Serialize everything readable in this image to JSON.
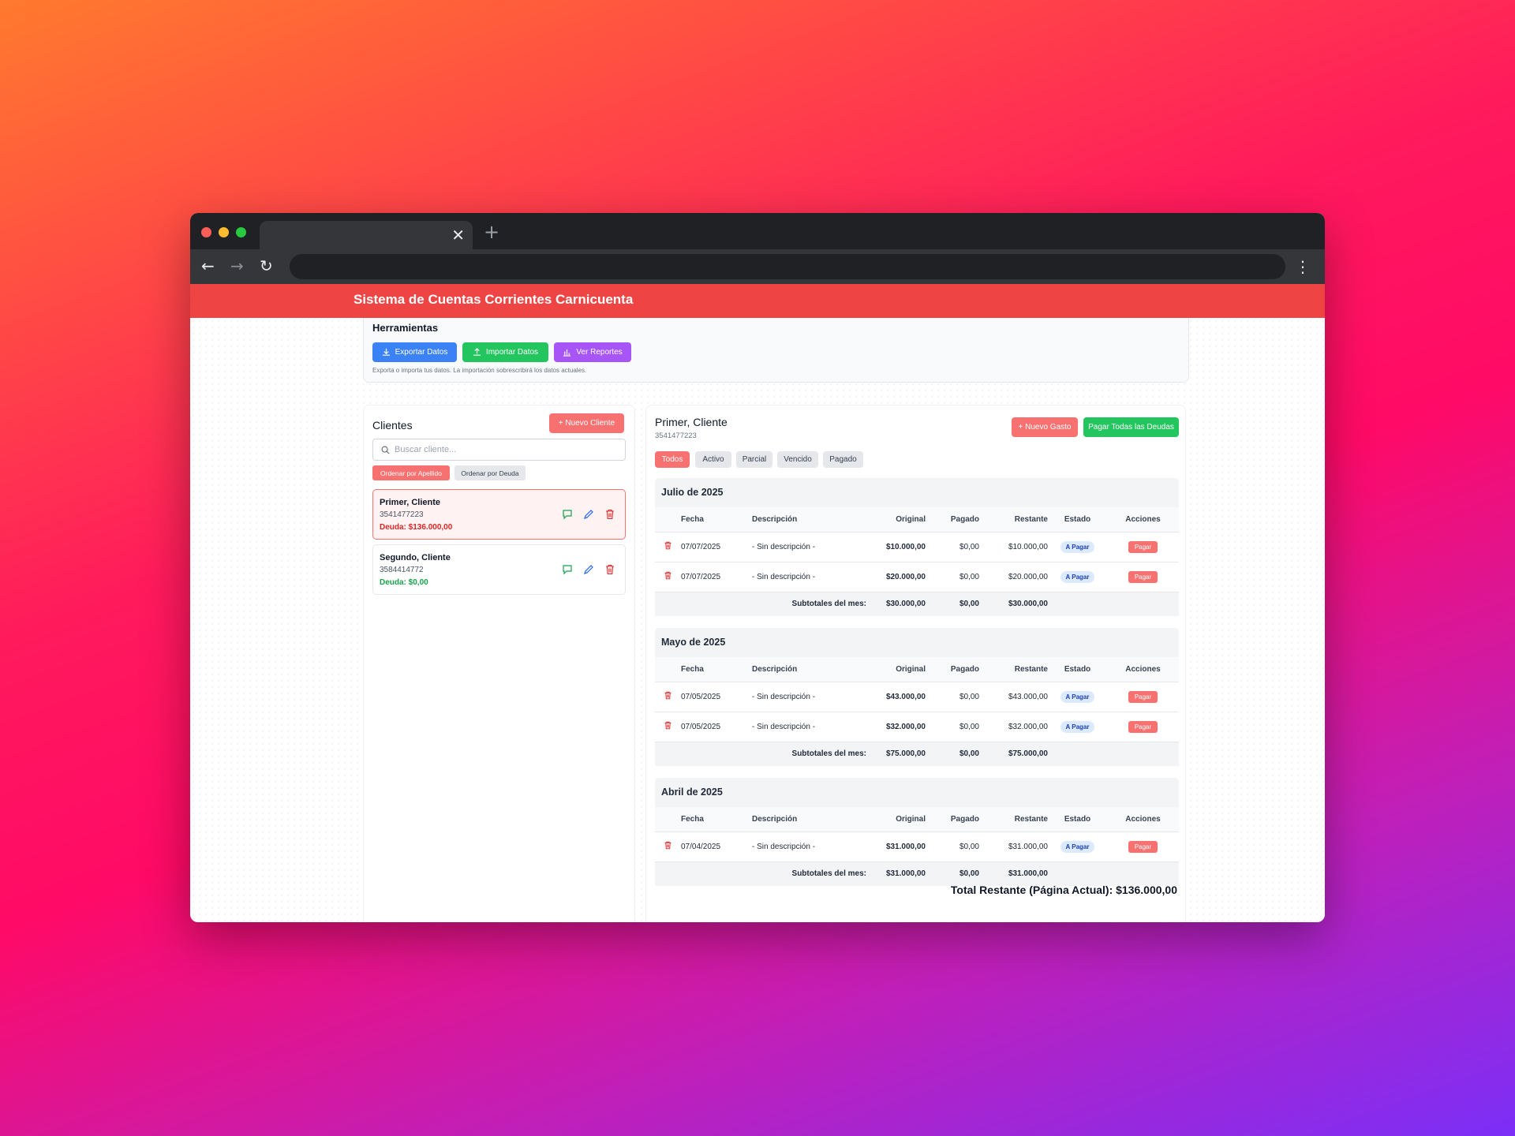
{
  "app": {
    "title": "Sistema de Cuentas Corrientes Carnicuenta"
  },
  "colors": {
    "header": "#ef4444",
    "export": "#3b82f6",
    "import": "#22c55e",
    "reports": "#a855f7",
    "accent": "#f87171"
  },
  "tools": {
    "title": "Herramientas",
    "export_label": "Exportar Datos",
    "import_label": "Importar Datos",
    "reports_label": "Ver Reportes",
    "note": "Exporta o importa tus datos. La importación sobrescribirá los datos actuales."
  },
  "clients": {
    "title": "Clientes",
    "new_label": "+ Nuevo Cliente",
    "search_placeholder": "Buscar cliente...",
    "sort_lastname": "Ordenar por Apellido",
    "sort_debt": "Ordenar por Deuda",
    "items": [
      {
        "name": "Primer, Cliente",
        "phone": "3541477223",
        "debt": "Deuda: $136.000,00"
      },
      {
        "name": "Segundo, Cliente",
        "phone": "3584414772",
        "debt": "Deuda: $0,00"
      }
    ]
  },
  "detail": {
    "name": "Primer, Cliente",
    "phone": "3541477223",
    "new_expense": "+ Nuevo Gasto",
    "pay_all": "Pagar Todas las Deudas",
    "filters": [
      "Todos",
      "Activo",
      "Parcial",
      "Vencido",
      "Pagado"
    ],
    "columns": [
      "Fecha",
      "Descripción",
      "Original",
      "Pagado",
      "Restante",
      "Estado",
      "Acciones"
    ],
    "subtotal_label": "Subtotales del mes:",
    "months": [
      {
        "title": "Julio de 2025",
        "rows": [
          {
            "fecha": "07/07/2025",
            "desc": "- Sin descripción -",
            "original": "$10.000,00",
            "pagado": "$0,00",
            "restante": "$10.000,00",
            "estado": "A Pagar",
            "accion": "Pagar"
          },
          {
            "fecha": "07/07/2025",
            "desc": "- Sin descripción -",
            "original": "$20.000,00",
            "pagado": "$0,00",
            "restante": "$20.000,00",
            "estado": "A Pagar",
            "accion": "Pagar"
          }
        ],
        "subtotals": {
          "original": "$30.000,00",
          "pagado": "$0,00",
          "restante": "$30.000,00"
        }
      },
      {
        "title": "Mayo de 2025",
        "rows": [
          {
            "fecha": "07/05/2025",
            "desc": "- Sin descripción -",
            "original": "$43.000,00",
            "pagado": "$0,00",
            "restante": "$43.000,00",
            "estado": "A Pagar",
            "accion": "Pagar"
          },
          {
            "fecha": "07/05/2025",
            "desc": "- Sin descripción -",
            "original": "$32.000,00",
            "pagado": "$0,00",
            "restante": "$32.000,00",
            "estado": "A Pagar",
            "accion": "Pagar"
          }
        ],
        "subtotals": {
          "original": "$75.000,00",
          "pagado": "$0,00",
          "restante": "$75.000,00"
        }
      },
      {
        "title": "Abril de 2025",
        "rows": [
          {
            "fecha": "07/04/2025",
            "desc": "- Sin descripción -",
            "original": "$31.000,00",
            "pagado": "$0,00",
            "restante": "$31.000,00",
            "estado": "A Pagar",
            "accion": "Pagar"
          }
        ],
        "subtotals": {
          "original": "$31.000,00",
          "pagado": "$0,00",
          "restante": "$31.000,00"
        }
      }
    ],
    "total": "Total Restante (Página Actual): $136.000,00"
  }
}
